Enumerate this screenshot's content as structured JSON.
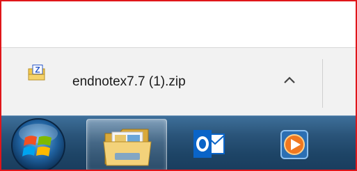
{
  "download_bar": {
    "file_name": "endnotex7.7 (1).zip",
    "file_icon": "zip-file-icon",
    "options_icon": "chevron-up-icon"
  },
  "taskbar": {
    "start_icon": "windows-start-orb-icon",
    "pinned": [
      {
        "name": "file-explorer",
        "icon": "folder-library-icon",
        "active": true
      },
      {
        "name": "outlook",
        "icon": "outlook-icon",
        "active": false
      },
      {
        "name": "media-player",
        "icon": "media-player-icon",
        "active": false
      }
    ]
  },
  "colors": {
    "highlight_frame": "#e0161a",
    "download_bar_bg": "#f2f2f2",
    "taskbar_bg": "#1d4466",
    "outlook_blue": "#0a64c8",
    "media_orange": "#f07820"
  }
}
